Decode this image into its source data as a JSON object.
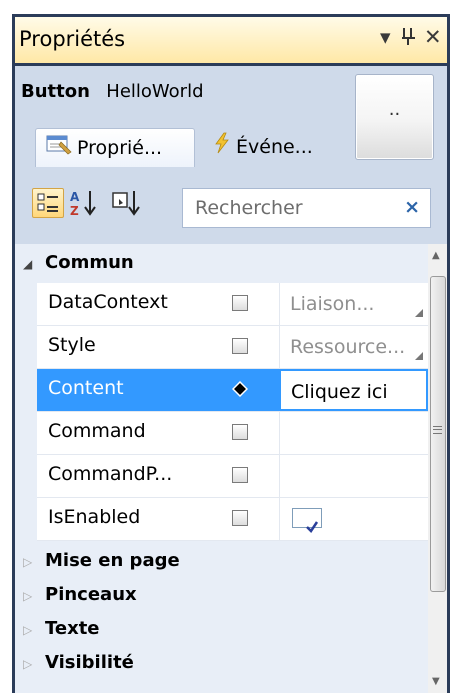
{
  "titlebar": {
    "title": "Propriétés",
    "dropdown_glyph": "▾",
    "pin_glyph": "ꟼ",
    "close_glyph": "✕"
  },
  "object": {
    "type": "Button",
    "name": "HelloWorld",
    "preview_text": ".."
  },
  "tabs": [
    {
      "label": "Proprié...",
      "icon": "properties-icon",
      "active": true
    },
    {
      "label": "Événe...",
      "icon": "lightning-icon",
      "active": false
    }
  ],
  "toolbar": {
    "categorized_icon": "categorized-view-icon",
    "alpha_sort_icon": "sort-az-icon",
    "events_sort_icon": "sort-bydef-icon"
  },
  "search": {
    "placeholder": "Rechercher",
    "clear_glyph": "×"
  },
  "grid": {
    "category_open": "Commun",
    "properties": [
      {
        "name": "DataContext",
        "value": "Liaison...",
        "has_grip": true,
        "marker": "square"
      },
      {
        "name": "Style",
        "value": "Ressource...",
        "has_grip": true,
        "marker": "square"
      },
      {
        "name": "Content",
        "value": "Cliquez ici",
        "has_grip": false,
        "marker": "diamond",
        "selected": true
      },
      {
        "name": "Command",
        "value": "",
        "has_grip": false,
        "marker": "square"
      },
      {
        "name": "CommandP...",
        "value": "",
        "has_grip": false,
        "marker": "square"
      },
      {
        "name": "IsEnabled",
        "value": "",
        "has_grip": false,
        "marker": "square",
        "checkbox": true,
        "checked": true
      }
    ],
    "categories_closed": [
      "Mise en page",
      "Pinceaux",
      "Texte",
      "Visibilité"
    ]
  },
  "colors": {
    "frame": "#2b3c59",
    "titlebar_accent": "#ffe8a6",
    "panel": "#cfdaea",
    "selection": "#3399ff"
  }
}
